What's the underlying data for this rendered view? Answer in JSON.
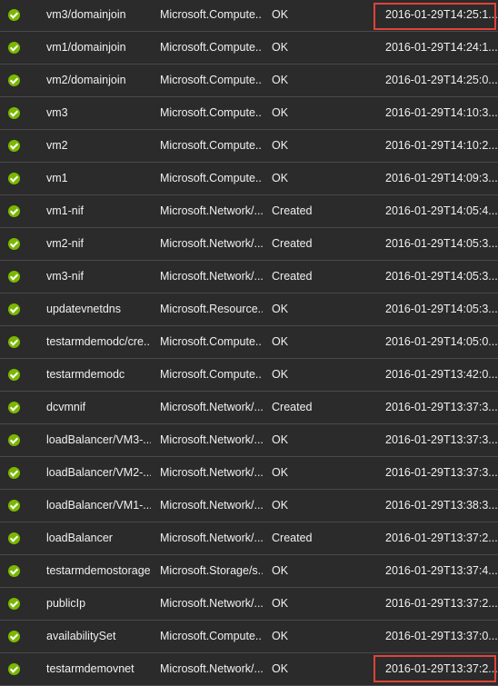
{
  "rows": [
    {
      "name": "vm3/domainjoin",
      "type": "Microsoft.Compute...",
      "status": "OK",
      "timestamp": "2016-01-29T14:25:1...",
      "highlighted": true
    },
    {
      "name": "vm1/domainjoin",
      "type": "Microsoft.Compute...",
      "status": "OK",
      "timestamp": "2016-01-29T14:24:1..."
    },
    {
      "name": "vm2/domainjoin",
      "type": "Microsoft.Compute...",
      "status": "OK",
      "timestamp": "2016-01-29T14:25:0..."
    },
    {
      "name": "vm3",
      "type": "Microsoft.Compute...",
      "status": "OK",
      "timestamp": "2016-01-29T14:10:3..."
    },
    {
      "name": "vm2",
      "type": "Microsoft.Compute...",
      "status": "OK",
      "timestamp": "2016-01-29T14:10:2..."
    },
    {
      "name": "vm1",
      "type": "Microsoft.Compute...",
      "status": "OK",
      "timestamp": "2016-01-29T14:09:3..."
    },
    {
      "name": "vm1-nif",
      "type": "Microsoft.Network/...",
      "status": "Created",
      "timestamp": "2016-01-29T14:05:4..."
    },
    {
      "name": "vm2-nif",
      "type": "Microsoft.Network/...",
      "status": "Created",
      "timestamp": "2016-01-29T14:05:3..."
    },
    {
      "name": "vm3-nif",
      "type": "Microsoft.Network/...",
      "status": "Created",
      "timestamp": "2016-01-29T14:05:3..."
    },
    {
      "name": "updatevnetdns",
      "type": "Microsoft.Resource...",
      "status": "OK",
      "timestamp": "2016-01-29T14:05:3..."
    },
    {
      "name": "testarmdemodc/cre...",
      "type": "Microsoft.Compute...",
      "status": "OK",
      "timestamp": "2016-01-29T14:05:0..."
    },
    {
      "name": "testarmdemodc",
      "type": "Microsoft.Compute...",
      "status": "OK",
      "timestamp": "2016-01-29T13:42:0..."
    },
    {
      "name": "dcvmnif",
      "type": "Microsoft.Network/...",
      "status": "Created",
      "timestamp": "2016-01-29T13:37:3..."
    },
    {
      "name": "loadBalancer/VM3-...",
      "type": "Microsoft.Network/...",
      "status": "OK",
      "timestamp": "2016-01-29T13:37:3..."
    },
    {
      "name": "loadBalancer/VM2-...",
      "type": "Microsoft.Network/...",
      "status": "OK",
      "timestamp": "2016-01-29T13:37:3..."
    },
    {
      "name": "loadBalancer/VM1-...",
      "type": "Microsoft.Network/...",
      "status": "OK",
      "timestamp": "2016-01-29T13:38:3..."
    },
    {
      "name": "loadBalancer",
      "type": "Microsoft.Network/...",
      "status": "Created",
      "timestamp": "2016-01-29T13:37:2..."
    },
    {
      "name": "testarmdemostorage",
      "type": "Microsoft.Storage/s...",
      "status": "OK",
      "timestamp": "2016-01-29T13:37:4..."
    },
    {
      "name": "publicIp",
      "type": "Microsoft.Network/...",
      "status": "OK",
      "timestamp": "2016-01-29T13:37:2..."
    },
    {
      "name": "availabilitySet",
      "type": "Microsoft.Compute...",
      "status": "OK",
      "timestamp": "2016-01-29T13:37:0..."
    },
    {
      "name": "testarmdemovnet",
      "type": "Microsoft.Network/...",
      "status": "OK",
      "timestamp": "2016-01-29T13:37:2...",
      "highlighted": true
    }
  ],
  "colors": {
    "background": "#2b2b2b",
    "text": "#f0f0f0",
    "success": "#7ab800",
    "highlight": "#e0423a",
    "divider": "#4a4a4a"
  },
  "icons": {
    "status": "success-check-icon"
  }
}
